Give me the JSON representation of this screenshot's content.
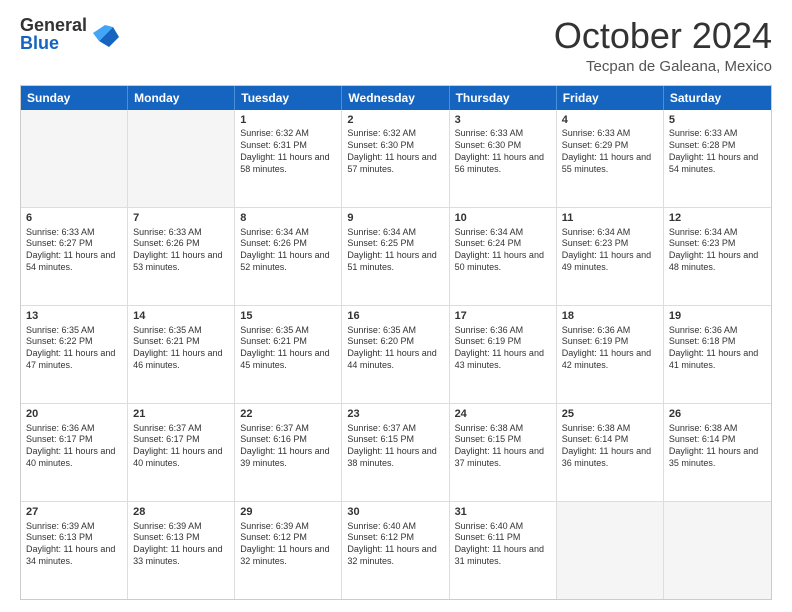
{
  "logo": {
    "general": "General",
    "blue": "Blue"
  },
  "title": "October 2024",
  "subtitle": "Tecpan de Galeana, Mexico",
  "days": [
    "Sunday",
    "Monday",
    "Tuesday",
    "Wednesday",
    "Thursday",
    "Friday",
    "Saturday"
  ],
  "rows": [
    [
      {
        "day": "",
        "info": "",
        "empty": true
      },
      {
        "day": "",
        "info": "",
        "empty": true
      },
      {
        "day": "1",
        "info": "Sunrise: 6:32 AM\nSunset: 6:31 PM\nDaylight: 11 hours and 58 minutes."
      },
      {
        "day": "2",
        "info": "Sunrise: 6:32 AM\nSunset: 6:30 PM\nDaylight: 11 hours and 57 minutes."
      },
      {
        "day": "3",
        "info": "Sunrise: 6:33 AM\nSunset: 6:30 PM\nDaylight: 11 hours and 56 minutes."
      },
      {
        "day": "4",
        "info": "Sunrise: 6:33 AM\nSunset: 6:29 PM\nDaylight: 11 hours and 55 minutes."
      },
      {
        "day": "5",
        "info": "Sunrise: 6:33 AM\nSunset: 6:28 PM\nDaylight: 11 hours and 54 minutes."
      }
    ],
    [
      {
        "day": "6",
        "info": "Sunrise: 6:33 AM\nSunset: 6:27 PM\nDaylight: 11 hours and 54 minutes."
      },
      {
        "day": "7",
        "info": "Sunrise: 6:33 AM\nSunset: 6:26 PM\nDaylight: 11 hours and 53 minutes."
      },
      {
        "day": "8",
        "info": "Sunrise: 6:34 AM\nSunset: 6:26 PM\nDaylight: 11 hours and 52 minutes."
      },
      {
        "day": "9",
        "info": "Sunrise: 6:34 AM\nSunset: 6:25 PM\nDaylight: 11 hours and 51 minutes."
      },
      {
        "day": "10",
        "info": "Sunrise: 6:34 AM\nSunset: 6:24 PM\nDaylight: 11 hours and 50 minutes."
      },
      {
        "day": "11",
        "info": "Sunrise: 6:34 AM\nSunset: 6:23 PM\nDaylight: 11 hours and 49 minutes."
      },
      {
        "day": "12",
        "info": "Sunrise: 6:34 AM\nSunset: 6:23 PM\nDaylight: 11 hours and 48 minutes."
      }
    ],
    [
      {
        "day": "13",
        "info": "Sunrise: 6:35 AM\nSunset: 6:22 PM\nDaylight: 11 hours and 47 minutes."
      },
      {
        "day": "14",
        "info": "Sunrise: 6:35 AM\nSunset: 6:21 PM\nDaylight: 11 hours and 46 minutes."
      },
      {
        "day": "15",
        "info": "Sunrise: 6:35 AM\nSunset: 6:21 PM\nDaylight: 11 hours and 45 minutes."
      },
      {
        "day": "16",
        "info": "Sunrise: 6:35 AM\nSunset: 6:20 PM\nDaylight: 11 hours and 44 minutes."
      },
      {
        "day": "17",
        "info": "Sunrise: 6:36 AM\nSunset: 6:19 PM\nDaylight: 11 hours and 43 minutes."
      },
      {
        "day": "18",
        "info": "Sunrise: 6:36 AM\nSunset: 6:19 PM\nDaylight: 11 hours and 42 minutes."
      },
      {
        "day": "19",
        "info": "Sunrise: 6:36 AM\nSunset: 6:18 PM\nDaylight: 11 hours and 41 minutes."
      }
    ],
    [
      {
        "day": "20",
        "info": "Sunrise: 6:36 AM\nSunset: 6:17 PM\nDaylight: 11 hours and 40 minutes."
      },
      {
        "day": "21",
        "info": "Sunrise: 6:37 AM\nSunset: 6:17 PM\nDaylight: 11 hours and 40 minutes."
      },
      {
        "day": "22",
        "info": "Sunrise: 6:37 AM\nSunset: 6:16 PM\nDaylight: 11 hours and 39 minutes."
      },
      {
        "day": "23",
        "info": "Sunrise: 6:37 AM\nSunset: 6:15 PM\nDaylight: 11 hours and 38 minutes."
      },
      {
        "day": "24",
        "info": "Sunrise: 6:38 AM\nSunset: 6:15 PM\nDaylight: 11 hours and 37 minutes."
      },
      {
        "day": "25",
        "info": "Sunrise: 6:38 AM\nSunset: 6:14 PM\nDaylight: 11 hours and 36 minutes."
      },
      {
        "day": "26",
        "info": "Sunrise: 6:38 AM\nSunset: 6:14 PM\nDaylight: 11 hours and 35 minutes."
      }
    ],
    [
      {
        "day": "27",
        "info": "Sunrise: 6:39 AM\nSunset: 6:13 PM\nDaylight: 11 hours and 34 minutes."
      },
      {
        "day": "28",
        "info": "Sunrise: 6:39 AM\nSunset: 6:13 PM\nDaylight: 11 hours and 33 minutes."
      },
      {
        "day": "29",
        "info": "Sunrise: 6:39 AM\nSunset: 6:12 PM\nDaylight: 11 hours and 32 minutes."
      },
      {
        "day": "30",
        "info": "Sunrise: 6:40 AM\nSunset: 6:12 PM\nDaylight: 11 hours and 32 minutes."
      },
      {
        "day": "31",
        "info": "Sunrise: 6:40 AM\nSunset: 6:11 PM\nDaylight: 11 hours and 31 minutes."
      },
      {
        "day": "",
        "info": "",
        "empty": true
      },
      {
        "day": "",
        "info": "",
        "empty": true
      }
    ]
  ]
}
